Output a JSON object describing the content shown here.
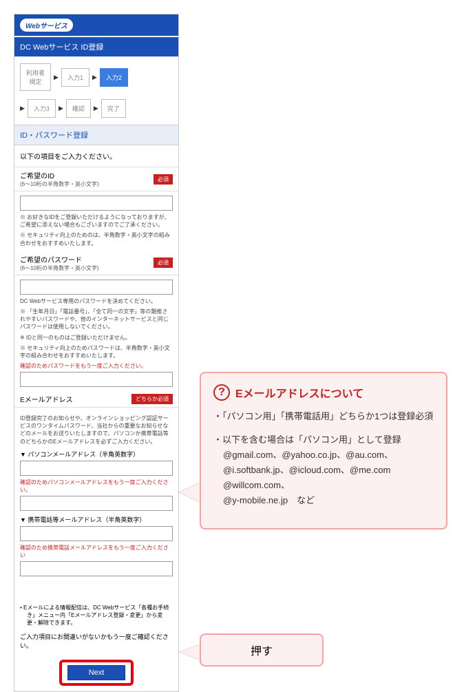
{
  "logo": "Webサービス",
  "pageTitle": "DC Webサービス ID登録",
  "steps": {
    "s1": "利用者\n規定",
    "s2": "入力1",
    "s3": "入力2",
    "s4": "入力3",
    "s5": "確認",
    "s6": "完了"
  },
  "sectionTitle": "ID・パスワード登録",
  "instruction": "以下の項目をご入力ください。",
  "badges": {
    "required": "必須",
    "either": "どちらか必須"
  },
  "idField": {
    "label": "ご希望のID",
    "hint": "(6〜10桁の半角数字・英小文字)",
    "note1": "※ お好きなIDをご登録いただけるようになっておりますが、ご希望に添えない場合もございますのでご了承ください。",
    "note2": "※ セキュリティ向上のためのは、半角数字・英小文字の組み合わせをおすすめいたします。"
  },
  "pwField": {
    "label": "ご希望のパスワード",
    "hint": "(6〜10桁の半角数字・英小文字)",
    "note0": "DC Webサービス専用のパスワードを決めてください。",
    "note1": "※ 「生年月日」「電話番号」、「全て同一の文字」等の類推されやすいパスワードや、他のインターネットサービスと同じパスワードは使用しないでください。",
    "note2": "※ IDと同一のものはご登録いただけません。",
    "note3": "※ セキュリティ向上のためパスワードは、半角数字・英小文字の組み合わせをおすすめいたします。",
    "confirm": "確認のためパスワードをもう一度ご入力ください。"
  },
  "emailField": {
    "label": "Eメールアドレス",
    "desc": "ID登録完了のお知らせや、オンラインショッピング認証サービスのワンタイムパスワード、当社からの重要なお知らせなどのメールをお送りいたしますので、パソコンか携帯電話等のどちらかのEメールアドレスを必ずご入力ください。",
    "pcLabel": "▼ パソコンメールアドレス（半角英数字）",
    "pcConfirm": "確認のためパソコンメールアドレスをもう一度ご入力ください。",
    "mobileLabel": "▼ 携帯電話等メールアドレス（半角英数字）",
    "mobileConfirm": "確認のため携帯電話メールアドレスをもう一度ご入力ください"
  },
  "bottom": {
    "note": "Eメールによる情報配信は、DC Webサービス「各種お手続き」メニュー内「Eメールアドレス登録・変更」から変更・解除できます。",
    "finalInstruction": "ご入力項目にお間違いがないかもう一度ご確認ください。",
    "nextLabel": "Next"
  },
  "callout1": {
    "title": "Eメールアドレスについて",
    "item1": "・「パソコン用」「携帯電話用」どちらか1つは登録必須",
    "item2a": "・以下を含む場合は「パソコン用」として登録",
    "item2b": "@gmail.com、@yahoo.co.jp、@au.com、@i.softbank.jp、@icloud.com、@me.com\n@willcom.com、\n@y-mobile.ne.jp　など"
  },
  "callout2": {
    "text": "押す"
  }
}
